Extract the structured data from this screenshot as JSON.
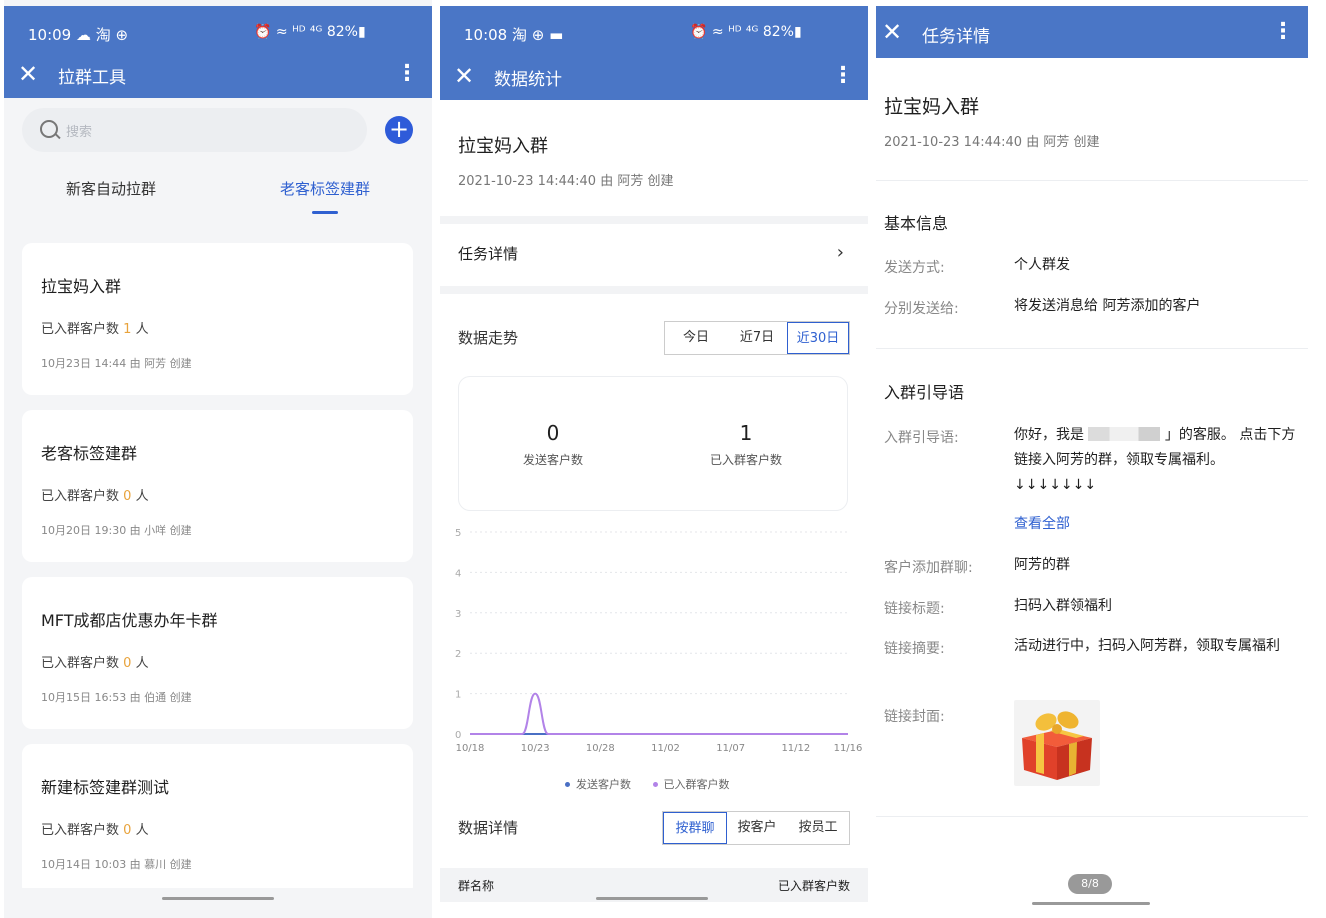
{
  "p1": {
    "status": {
      "time": "10:09 ☁ 淘 ⊕",
      "right": "⏰ ≈ ᴴᴰ ⁴ᴳ 82%▮"
    },
    "appbar": {
      "title": "拉群工具"
    },
    "search": {
      "placeholder": "搜索"
    },
    "tabs": [
      "新客自动拉群",
      "老客标签建群"
    ],
    "count_prefix": "已入群客户数",
    "count_suffix": "人",
    "cards": [
      {
        "name": "拉宝妈入群",
        "count": "1",
        "meta": "10月23日 14:44   由 阿芳 创建"
      },
      {
        "name": "老客标签建群",
        "count": "0",
        "meta": "10月20日 19:30   由 小咩 创建"
      },
      {
        "name": "MFT成都店优惠办年卡群",
        "count": "0",
        "meta": "10月15日 16:53   由 伯通 创建"
      },
      {
        "name": "新建标签建群测试",
        "count": "0",
        "meta": "10月14日 10:03   由 慕川 创建"
      }
    ]
  },
  "p2": {
    "status": {
      "time": "10:08 淘 ⊕ ▬",
      "right": "⏰ ≈ ᴴᴰ ⁴ᴳ 82%▮"
    },
    "appbar": {
      "title": "数据统计"
    },
    "task": {
      "title": "拉宝妈入群",
      "meta": "2021-10-23 14:44:40   由 阿芳 创建"
    },
    "detail_row": "任务详情",
    "trend": {
      "label": "数据走势",
      "ranges": [
        "今日",
        "近7日",
        "近30日"
      ],
      "active": "近30日"
    },
    "stats": [
      {
        "value": "0",
        "label": "发送客户数"
      },
      {
        "value": "1",
        "label": "已入群客户数"
      }
    ],
    "details": {
      "label": "数据详情",
      "modes": [
        "按群聊",
        "按客户",
        "按员工"
      ],
      "active": "按群聊"
    },
    "table_headers": [
      "群名称",
      "已入群客户数"
    ]
  },
  "p3": {
    "appbar": {
      "title": "任务详情"
    },
    "task": {
      "title": "拉宝妈入群",
      "meta": "2021-10-23 14:44:40   由 阿芳 创建"
    },
    "basic": {
      "heading": "基本信息",
      "send_method_label": "发送方式:",
      "send_method": "个人群发",
      "send_to_label": "分别发送给:",
      "send_to": "将发送消息给 阿芳添加的客户"
    },
    "guide": {
      "heading": "入群引导语",
      "label": "入群引导语:",
      "text_before": "你好，我是",
      "text_after": "」的客服。 点击下方链接入阿芳的群，领取专属福利。↓↓↓↓↓↓↓",
      "view_all": "查看全部",
      "group_label": "客户添加群聊:",
      "group": "阿芳的群",
      "link_title_label": "链接标题:",
      "link_title": "扫码入群领福利",
      "link_summary_label": "链接摘要:",
      "link_summary": "活动进行中，扫码入阿芳群，领取专属福利",
      "cover_label": "链接封面:"
    },
    "pager": "8/8"
  },
  "colors": {
    "primary": "#4a76c6",
    "accent": "#2f60d0",
    "send_series": "#4a6fc4",
    "join_series": "#b283e8",
    "count_highlight": "#e8a33c"
  },
  "chart_data": {
    "type": "line",
    "x": [
      "10/18",
      "10/19",
      "10/20",
      "10/21",
      "10/22",
      "10/23",
      "10/24",
      "10/25",
      "10/26",
      "10/27",
      "10/28",
      "10/29",
      "10/30",
      "10/31",
      "11/01",
      "11/02",
      "11/03",
      "11/04",
      "11/05",
      "11/06",
      "11/07",
      "11/08",
      "11/09",
      "11/10",
      "11/11",
      "11/12",
      "11/13",
      "11/14",
      "11/15",
      "11/16"
    ],
    "xticks": [
      "10/18",
      "10/23",
      "10/28",
      "11/02",
      "11/07",
      "11/12",
      "11/16"
    ],
    "ylim": [
      0,
      5
    ],
    "yticks": [
      0,
      1,
      2,
      3,
      4,
      5
    ],
    "series": [
      {
        "name": "发送客户数",
        "values": [
          0,
          0,
          0,
          0,
          0,
          0,
          0,
          0,
          0,
          0,
          0,
          0,
          0,
          0,
          0,
          0,
          0,
          0,
          0,
          0,
          0,
          0,
          0,
          0,
          0,
          0,
          0,
          0,
          0,
          0
        ]
      },
      {
        "name": "已入群客户数",
        "values": [
          0,
          0,
          0,
          0,
          0,
          1,
          0,
          0,
          0,
          0,
          0,
          0,
          0,
          0,
          0,
          0,
          0,
          0,
          0,
          0,
          0,
          0,
          0,
          0,
          0,
          0,
          0,
          0,
          0,
          0
        ]
      }
    ],
    "legend": "bottom",
    "grid": true
  }
}
